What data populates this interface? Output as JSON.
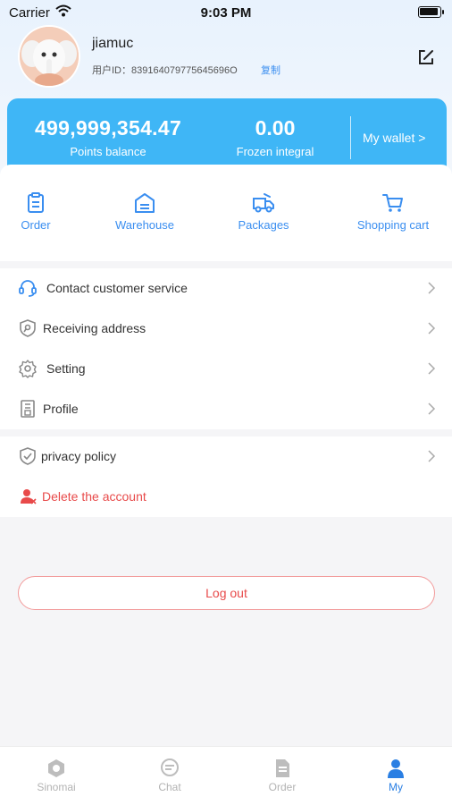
{
  "status_bar": {
    "carrier": "Carrier",
    "time": "9:03 PM"
  },
  "profile": {
    "username": "jiamuc",
    "user_id_label": "用户ID：839164079775645696O",
    "copy_label": "复制"
  },
  "wallet": {
    "points_value": "499,999,354.47",
    "points_label": "Points balance",
    "frozen_value": "0.00",
    "frozen_label": "Frozen integral",
    "link_label": "My wallet >"
  },
  "shortcuts": [
    {
      "label": "Order",
      "icon": "order-icon"
    },
    {
      "label": "Warehouse",
      "icon": "warehouse-icon"
    },
    {
      "label": "Packages",
      "icon": "packages-icon"
    },
    {
      "label": "Shopping cart",
      "icon": "cart-icon"
    }
  ],
  "menu": [
    {
      "label": "Contact customer service",
      "icon": "headset-icon"
    },
    {
      "label": "Receiving address",
      "icon": "address-icon"
    },
    {
      "label": "Setting",
      "icon": "gear-icon"
    },
    {
      "label": "Profile",
      "icon": "profile-doc-icon"
    }
  ],
  "menu2": [
    {
      "label": "privacy policy",
      "icon": "shield-check-icon"
    },
    {
      "label": "Delete the account",
      "icon": "delete-user-icon"
    }
  ],
  "logout_label": "Log out",
  "tabs": [
    {
      "label": "Sinomai",
      "icon": "home-icon",
      "active": false
    },
    {
      "label": "Chat",
      "icon": "chat-icon",
      "active": false
    },
    {
      "label": "Order",
      "icon": "order-doc-icon",
      "active": false
    },
    {
      "label": "My",
      "icon": "user-icon",
      "active": true
    }
  ],
  "colors": {
    "accent": "#3a8ef0",
    "wallet_bg": "#3fb6f6",
    "danger": "#e84a4a",
    "tab_active": "#2a7fe3"
  }
}
